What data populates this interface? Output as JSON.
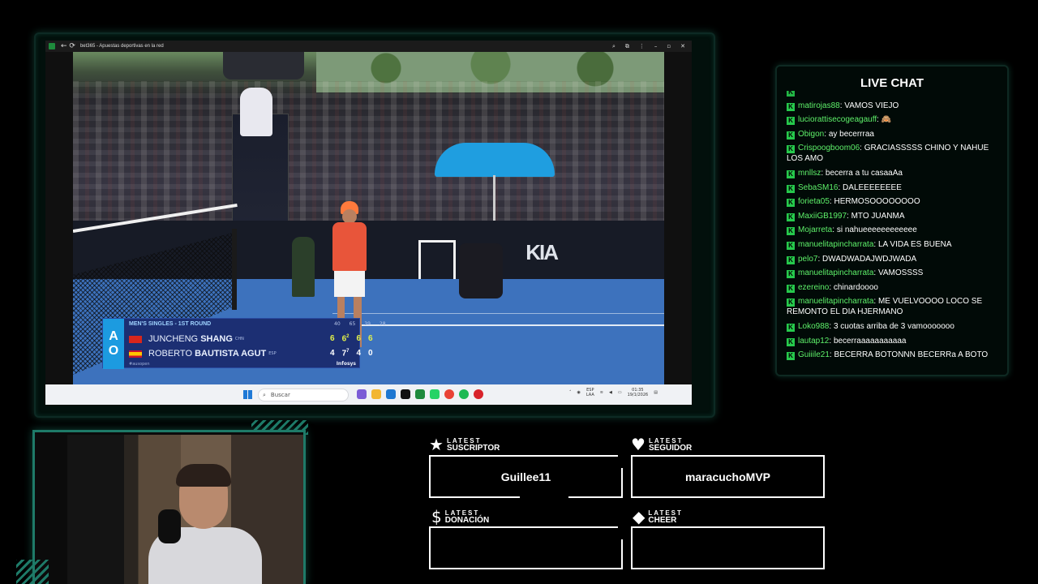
{
  "browser": {
    "title": "bet365 - Apuestas deportivas en la red",
    "nav_glyphs": "← ⟳"
  },
  "scoreboard": {
    "logo_top": "A",
    "logo_bottom": "O",
    "round": "MEN'S SINGLES - 1ST ROUND",
    "stats": [
      "40",
      "65",
      "39",
      "28"
    ],
    "player1": {
      "first": "JUNCHENG",
      "last": "SHANG",
      "nat": "CHN",
      "sets": [
        "6",
        "6",
        "6",
        "6"
      ],
      "tiebreak_sup": "2"
    },
    "player2": {
      "first": "ROBERTO",
      "last": "BAUTISTA AGUT",
      "nat": "ESP",
      "sets": [
        "4",
        "7",
        "4",
        "0"
      ],
      "tiebreak_sup": "7"
    },
    "footer": "#ausopen",
    "sponsor": "Infosys"
  },
  "court_brand": "KIA",
  "taskbar": {
    "search_placeholder": "Buscar",
    "lang_top": "ESP",
    "lang_bottom": "LAA",
    "time": "01:35",
    "date": "19/1/2026"
  },
  "chat": {
    "title": "LIVE CHAT",
    "messages": [
      {
        "user": "matirojas88",
        "text": "VAMOS VIEJO"
      },
      {
        "user": "luciorattisecogeagauff",
        "text": "🙈"
      },
      {
        "user": "Obigon",
        "text": "ay becerrraa"
      },
      {
        "user": "Crispoogboom06",
        "text": "GRACIASSSSS CHINO Y NAHUE LOS AMO"
      },
      {
        "user": "mnllsz",
        "text": "becerra a tu casaaAa"
      },
      {
        "user": "SebaSM16",
        "text": "DALEEEEEEEE"
      },
      {
        "user": "forieta05",
        "text": "HERMOSOOOOOOOO"
      },
      {
        "user": "MaxiiGB1997",
        "text": "MTO JUANMA"
      },
      {
        "user": "Mojarreta",
        "text": "si nahueeeeeeeeeeee"
      },
      {
        "user": "manuelitapincharrata",
        "text": "LA VIDA ES BUENA"
      },
      {
        "user": "pelo7",
        "text": "DWADWADAJWDJWADA"
      },
      {
        "user": "manuelitapincharrata",
        "text": "VAMOSSSS"
      },
      {
        "user": "ezereino",
        "text": "chinardoooo"
      },
      {
        "user": "manuelitapincharrata",
        "text": "ME VUELVOOOO LOCO SE REMONTO EL DIA HJERMANO"
      },
      {
        "user": "Loko988",
        "text": "3 cuotas arriba de 3 vamooooooo"
      },
      {
        "user": "lautap12",
        "text": "becerraaaaaaaaaaa"
      },
      {
        "user": "Guiiile21",
        "text": "BECERRA BOTONNN BECERRa A BOTO"
      }
    ]
  },
  "alerts": {
    "subscriber": {
      "latest": "LATEST",
      "label": "SUSCRIPTOR",
      "value": "Guillee11",
      "icon": "★"
    },
    "follower": {
      "latest": "LATEST",
      "label": "SEGUIDOR",
      "value": "maracuchoMVP",
      "icon": "♥"
    },
    "donation": {
      "latest": "LATEST",
      "label": "DONACIÓN",
      "value": "",
      "icon": "$"
    },
    "cheer": {
      "latest": "LATEST",
      "label": "CHEER",
      "value": "",
      "icon": "◆"
    }
  },
  "colors": {
    "accent_green": "#1e7a68",
    "chat_user": "#5ef06a",
    "kick_badge": "#26c94c",
    "scoreboard_blue": "#1c2f73",
    "court_blue": "#3d72bd"
  }
}
